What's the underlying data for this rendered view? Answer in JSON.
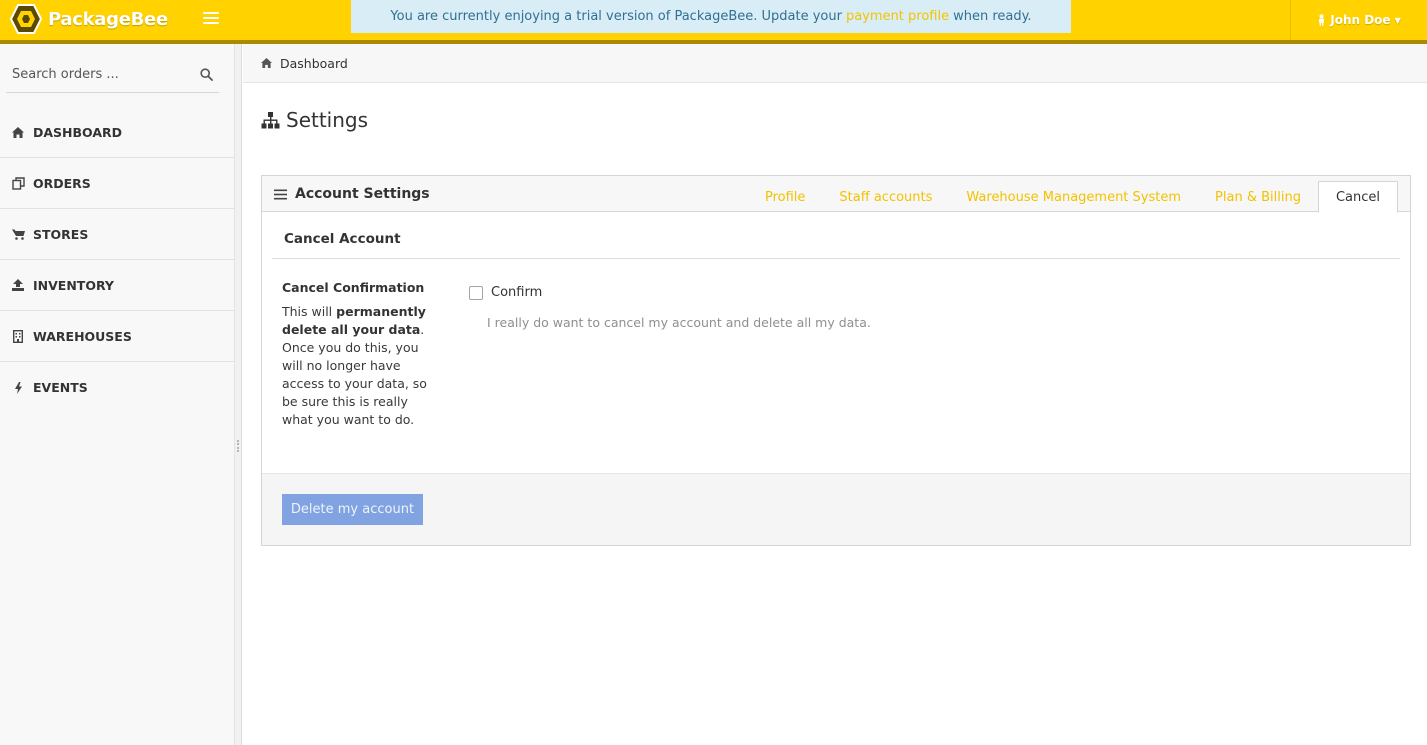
{
  "brand": {
    "name": "PackageBee"
  },
  "banner": {
    "text_before": "You are currently enjoying a trial version of PackageBee. Update your",
    "link_text": "payment profile",
    "text_after": "when ready."
  },
  "user": {
    "name": "John Doe"
  },
  "search": {
    "placeholder": "Search orders ..."
  },
  "sidebar": {
    "items": [
      {
        "label": "DASHBOARD",
        "icon": "home-icon"
      },
      {
        "label": "ORDERS",
        "icon": "copy-icon"
      },
      {
        "label": "STORES",
        "icon": "cart-icon"
      },
      {
        "label": "INVENTORY",
        "icon": "upload-icon"
      },
      {
        "label": "WAREHOUSES",
        "icon": "building-icon"
      },
      {
        "label": "EVENTS",
        "icon": "bolt-icon"
      }
    ]
  },
  "breadcrumb": {
    "current": "Dashboard"
  },
  "page": {
    "title": "Settings"
  },
  "panel": {
    "title": "Account Settings",
    "tabs": [
      {
        "label": "Profile",
        "active": false
      },
      {
        "label": "Staff accounts",
        "active": false
      },
      {
        "label": "Warehouse Management System",
        "active": false
      },
      {
        "label": "Plan & Billing",
        "active": false
      },
      {
        "label": "Cancel",
        "active": true
      }
    ],
    "section_title": "Cancel Account",
    "confirm_label": "Cancel Confirmation",
    "desc_before": "This will",
    "desc_bold": "permanently delete all your data",
    "desc_after": ". Once you do this, you will no longer have access to your data, so be sure this is really what you want to do.",
    "checkbox_label": "Confirm",
    "help_text": "I really do want to cancel my account and delete all my data.",
    "delete_button": "Delete my account"
  },
  "colors": {
    "topbar": "#ffd200",
    "accent": "#f2c200",
    "banner_bg": "#d9edf7",
    "banner_text": "#31708f",
    "delete_button": "#7b9fe0"
  }
}
